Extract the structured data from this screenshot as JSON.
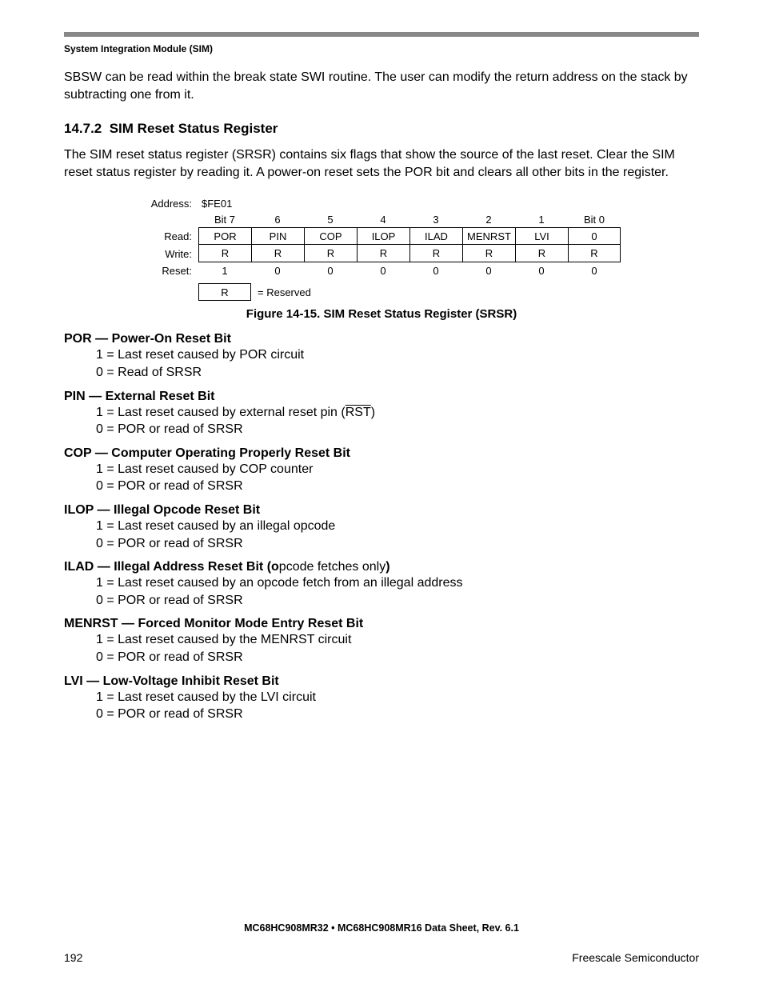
{
  "running_head": "System Integration Module (SIM)",
  "intro_para": "SBSW can be read within the break state SWI routine. The user can modify the return address on the stack by subtracting one from it.",
  "section": {
    "number": "14.7.2",
    "title": "SIM Reset Status Register"
  },
  "section_para": "The SIM reset status register (SRSR) contains six flags that show the source of the last reset. Clear the SIM reset status register by reading it. A power-on reset sets the POR bit and clears all other bits in the register.",
  "register": {
    "address_label": "Address:",
    "address_value": "$FE01",
    "bit_header_left": "Bit 7",
    "bit_headers_mid": [
      "6",
      "5",
      "4",
      "3",
      "2",
      "1"
    ],
    "bit_header_right": "Bit 0",
    "read_label": "Read:",
    "read_values": [
      "POR",
      "PIN",
      "COP",
      "ILOP",
      "ILAD",
      "MENRST",
      "LVI",
      "0"
    ],
    "write_label": "Write:",
    "write_values": [
      "R",
      "R",
      "R",
      "R",
      "R",
      "R",
      "R",
      "R"
    ],
    "reset_label": "Reset:",
    "reset_values": [
      "1",
      "0",
      "0",
      "0",
      "0",
      "0",
      "0",
      "0"
    ],
    "legend_symbol": "R",
    "legend_text": "= Reserved"
  },
  "figure_caption": "Figure 14-15. SIM Reset Status Register (SRSR)",
  "fields": [
    {
      "title_bold": "POR — Power-On Reset Bit",
      "lines": [
        "1 = Last reset caused by POR circuit",
        "0 = Read of SRSR"
      ]
    },
    {
      "title_bold": "PIN — External Reset Bit",
      "line1_pre": "1 = Last reset caused by external reset pin (",
      "line1_over": "RST",
      "line1_post": ")",
      "lines_rest": [
        "0 = POR or read of SRSR"
      ]
    },
    {
      "title_bold": "COP — Computer Operating Properly Reset Bit",
      "lines": [
        "1 = Last reset caused by COP counter",
        "0 = POR or read of SRSR"
      ]
    },
    {
      "title_bold": "ILOP — Illegal Opcode Reset Bit",
      "lines": [
        "1 = Last reset caused by an illegal opcode",
        "0 = POR or read of SRSR"
      ]
    },
    {
      "title_bold_pre": "ILAD — Illegal Address Reset Bit (o",
      "title_normal": "pcode fetches only",
      "title_bold_post": ")",
      "lines": [
        "1 = Last reset caused by an opcode fetch from an illegal address",
        "0 = POR or read of SRSR"
      ]
    },
    {
      "title_bold": "MENRST — Forced Monitor Mode Entry Reset Bit",
      "lines": [
        "1 = Last reset caused by the MENRST circuit",
        "0 = POR or read of SRSR"
      ]
    },
    {
      "title_bold": "LVI — Low-Voltage Inhibit Reset Bit",
      "lines": [
        "1 = Last reset caused by the LVI circuit",
        "0 = POR or read of SRSR"
      ]
    }
  ],
  "footer": {
    "doc_title": "MC68HC908MR32 • MC68HC908MR16 Data Sheet, Rev. 6.1",
    "page_number": "192",
    "company": "Freescale Semiconductor"
  }
}
